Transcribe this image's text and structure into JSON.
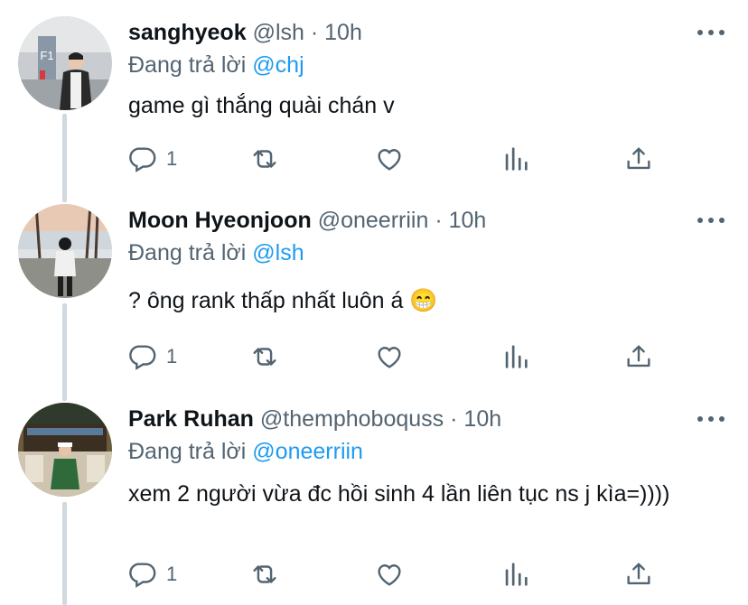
{
  "tweets": [
    {
      "name": "sanghyeok",
      "handle": "@lsh",
      "dot": "·",
      "time": "10h",
      "reply_prefix": "Đang trả lời",
      "reply_to": "@chj",
      "text": "game gì thắng quài chán v",
      "reply_count": "1"
    },
    {
      "name": "Moon Hyeonjoon",
      "handle": "@oneerriin",
      "dot": "·",
      "time": "10h",
      "reply_prefix": "Đang trả lời",
      "reply_to": "@lsh",
      "text": "? ông rank thấp nhất luôn á 😁",
      "reply_count": "1"
    },
    {
      "name": "Park Ruhan",
      "handle": "@themphoboquss",
      "dot": "·",
      "time": "10h",
      "reply_prefix": "Đang trả lời",
      "reply_to": "@oneerriin",
      "text": "xem 2 người vừa đc hồi sinh 4 lần liên tục ns j kìa=))))",
      "reply_count": "1"
    }
  ],
  "avatar_sign_text": "F1",
  "icons": [
    "reply-icon",
    "retweet-icon",
    "like-icon",
    "analytics-icon",
    "share-icon",
    "more-icon"
  ],
  "colors": {
    "link": "#1d9bf0",
    "secondary": "#536471",
    "line": "#cfd9de"
  }
}
